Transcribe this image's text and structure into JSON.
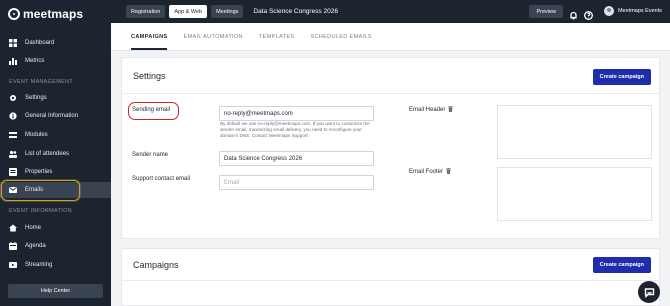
{
  "brand": {
    "name": "meetmaps"
  },
  "sidebar": {
    "items_top": [
      {
        "label": "Dashboard",
        "icon": "grid-icon"
      },
      {
        "label": "Metrics",
        "icon": "chart-icon"
      }
    ],
    "section_event_management": "EVENT MANAGEMENT",
    "items_management": [
      {
        "label": "Settings",
        "icon": "gear-icon"
      },
      {
        "label": "General Information",
        "icon": "info-icon"
      },
      {
        "label": "Modules",
        "icon": "modules-icon"
      },
      {
        "label": "List of attendees",
        "icon": "list-icon"
      },
      {
        "label": "Properties",
        "icon": "properties-icon"
      },
      {
        "label": "Emails",
        "icon": "mail-icon"
      }
    ],
    "section_event_information": "EVENT INFORMATION",
    "items_information": [
      {
        "label": "Home",
        "icon": "home-icon"
      },
      {
        "label": "Agenda",
        "icon": "calendar-icon"
      },
      {
        "label": "Streaming",
        "icon": "streaming-icon"
      }
    ],
    "help_center": "Help Center"
  },
  "topbar": {
    "tabs": [
      "Registration",
      "App & Web",
      "Meetings"
    ],
    "event_title": "Data Science Congress 2026",
    "preview": "Preview",
    "user": "Meetmaps Events"
  },
  "subtabs": [
    "CAMPAIGNS",
    "EMAIL AUTOMATION",
    "TEMPLATES",
    "SCHEDULED EMAILS"
  ],
  "settings": {
    "title": "Settings",
    "create_button": "Create campaign",
    "sending_email_label": "Sending email",
    "sending_email_value": "no-reply@meetmaps.com",
    "sending_email_help": "By default we use no-reply@meetmaps.com. If you want to customize the sender email, maximizing email delivery, you need to reconfigure your domain's DNS. Contact Meetmaps Support.",
    "sender_name_label": "Sender name",
    "sender_name_value": "Data Science Congress 2026",
    "support_email_label": "Support contact email",
    "support_email_placeholder": "Email",
    "email_header_label": "Email Header",
    "email_footer_label": "Email Footer"
  },
  "campaigns": {
    "title": "Campaigns",
    "create_button": "Create campaign"
  },
  "colors": {
    "sidebar_bg": "#1c2430",
    "primary_button": "#1f2dad",
    "highlight_red": "#c62828",
    "highlight_gold": "#c9a227"
  }
}
